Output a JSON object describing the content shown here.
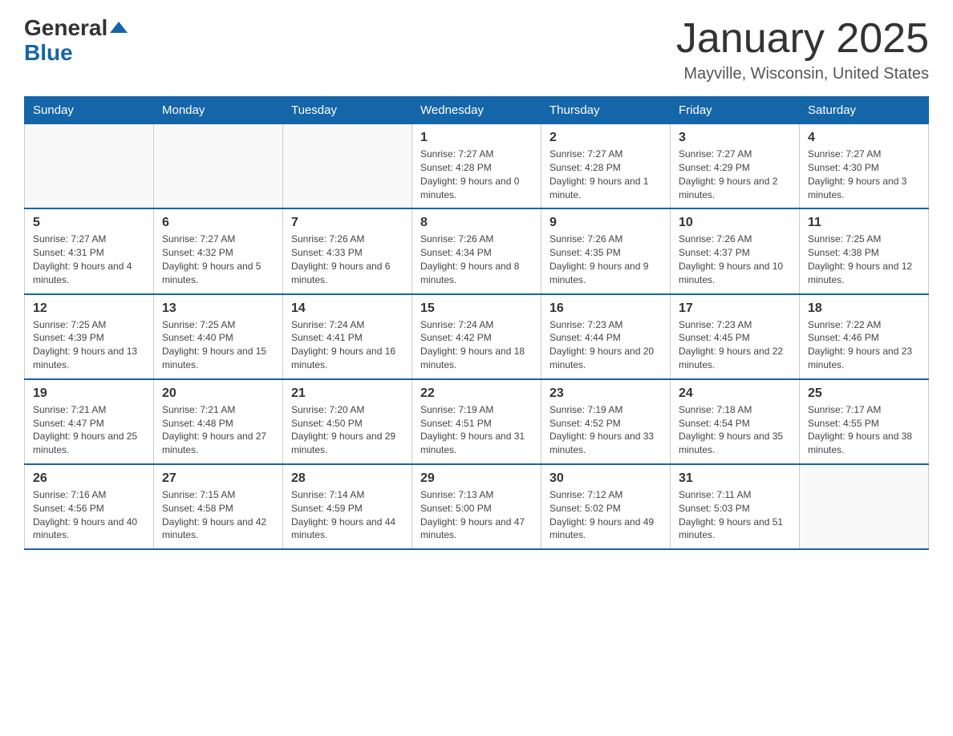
{
  "logo": {
    "general": "General",
    "blue": "Blue"
  },
  "header": {
    "title": "January 2025",
    "subtitle": "Mayville, Wisconsin, United States"
  },
  "weekdays": [
    "Sunday",
    "Monday",
    "Tuesday",
    "Wednesday",
    "Thursday",
    "Friday",
    "Saturday"
  ],
  "weeks": [
    [
      {
        "day": "",
        "sunrise": "",
        "sunset": "",
        "daylight": ""
      },
      {
        "day": "",
        "sunrise": "",
        "sunset": "",
        "daylight": ""
      },
      {
        "day": "",
        "sunrise": "",
        "sunset": "",
        "daylight": ""
      },
      {
        "day": "1",
        "sunrise": "Sunrise: 7:27 AM",
        "sunset": "Sunset: 4:28 PM",
        "daylight": "Daylight: 9 hours and 0 minutes."
      },
      {
        "day": "2",
        "sunrise": "Sunrise: 7:27 AM",
        "sunset": "Sunset: 4:28 PM",
        "daylight": "Daylight: 9 hours and 1 minute."
      },
      {
        "day": "3",
        "sunrise": "Sunrise: 7:27 AM",
        "sunset": "Sunset: 4:29 PM",
        "daylight": "Daylight: 9 hours and 2 minutes."
      },
      {
        "day": "4",
        "sunrise": "Sunrise: 7:27 AM",
        "sunset": "Sunset: 4:30 PM",
        "daylight": "Daylight: 9 hours and 3 minutes."
      }
    ],
    [
      {
        "day": "5",
        "sunrise": "Sunrise: 7:27 AM",
        "sunset": "Sunset: 4:31 PM",
        "daylight": "Daylight: 9 hours and 4 minutes."
      },
      {
        "day": "6",
        "sunrise": "Sunrise: 7:27 AM",
        "sunset": "Sunset: 4:32 PM",
        "daylight": "Daylight: 9 hours and 5 minutes."
      },
      {
        "day": "7",
        "sunrise": "Sunrise: 7:26 AM",
        "sunset": "Sunset: 4:33 PM",
        "daylight": "Daylight: 9 hours and 6 minutes."
      },
      {
        "day": "8",
        "sunrise": "Sunrise: 7:26 AM",
        "sunset": "Sunset: 4:34 PM",
        "daylight": "Daylight: 9 hours and 8 minutes."
      },
      {
        "day": "9",
        "sunrise": "Sunrise: 7:26 AM",
        "sunset": "Sunset: 4:35 PM",
        "daylight": "Daylight: 9 hours and 9 minutes."
      },
      {
        "day": "10",
        "sunrise": "Sunrise: 7:26 AM",
        "sunset": "Sunset: 4:37 PM",
        "daylight": "Daylight: 9 hours and 10 minutes."
      },
      {
        "day": "11",
        "sunrise": "Sunrise: 7:25 AM",
        "sunset": "Sunset: 4:38 PM",
        "daylight": "Daylight: 9 hours and 12 minutes."
      }
    ],
    [
      {
        "day": "12",
        "sunrise": "Sunrise: 7:25 AM",
        "sunset": "Sunset: 4:39 PM",
        "daylight": "Daylight: 9 hours and 13 minutes."
      },
      {
        "day": "13",
        "sunrise": "Sunrise: 7:25 AM",
        "sunset": "Sunset: 4:40 PM",
        "daylight": "Daylight: 9 hours and 15 minutes."
      },
      {
        "day": "14",
        "sunrise": "Sunrise: 7:24 AM",
        "sunset": "Sunset: 4:41 PM",
        "daylight": "Daylight: 9 hours and 16 minutes."
      },
      {
        "day": "15",
        "sunrise": "Sunrise: 7:24 AM",
        "sunset": "Sunset: 4:42 PM",
        "daylight": "Daylight: 9 hours and 18 minutes."
      },
      {
        "day": "16",
        "sunrise": "Sunrise: 7:23 AM",
        "sunset": "Sunset: 4:44 PM",
        "daylight": "Daylight: 9 hours and 20 minutes."
      },
      {
        "day": "17",
        "sunrise": "Sunrise: 7:23 AM",
        "sunset": "Sunset: 4:45 PM",
        "daylight": "Daylight: 9 hours and 22 minutes."
      },
      {
        "day": "18",
        "sunrise": "Sunrise: 7:22 AM",
        "sunset": "Sunset: 4:46 PM",
        "daylight": "Daylight: 9 hours and 23 minutes."
      }
    ],
    [
      {
        "day": "19",
        "sunrise": "Sunrise: 7:21 AM",
        "sunset": "Sunset: 4:47 PM",
        "daylight": "Daylight: 9 hours and 25 minutes."
      },
      {
        "day": "20",
        "sunrise": "Sunrise: 7:21 AM",
        "sunset": "Sunset: 4:48 PM",
        "daylight": "Daylight: 9 hours and 27 minutes."
      },
      {
        "day": "21",
        "sunrise": "Sunrise: 7:20 AM",
        "sunset": "Sunset: 4:50 PM",
        "daylight": "Daylight: 9 hours and 29 minutes."
      },
      {
        "day": "22",
        "sunrise": "Sunrise: 7:19 AM",
        "sunset": "Sunset: 4:51 PM",
        "daylight": "Daylight: 9 hours and 31 minutes."
      },
      {
        "day": "23",
        "sunrise": "Sunrise: 7:19 AM",
        "sunset": "Sunset: 4:52 PM",
        "daylight": "Daylight: 9 hours and 33 minutes."
      },
      {
        "day": "24",
        "sunrise": "Sunrise: 7:18 AM",
        "sunset": "Sunset: 4:54 PM",
        "daylight": "Daylight: 9 hours and 35 minutes."
      },
      {
        "day": "25",
        "sunrise": "Sunrise: 7:17 AM",
        "sunset": "Sunset: 4:55 PM",
        "daylight": "Daylight: 9 hours and 38 minutes."
      }
    ],
    [
      {
        "day": "26",
        "sunrise": "Sunrise: 7:16 AM",
        "sunset": "Sunset: 4:56 PM",
        "daylight": "Daylight: 9 hours and 40 minutes."
      },
      {
        "day": "27",
        "sunrise": "Sunrise: 7:15 AM",
        "sunset": "Sunset: 4:58 PM",
        "daylight": "Daylight: 9 hours and 42 minutes."
      },
      {
        "day": "28",
        "sunrise": "Sunrise: 7:14 AM",
        "sunset": "Sunset: 4:59 PM",
        "daylight": "Daylight: 9 hours and 44 minutes."
      },
      {
        "day": "29",
        "sunrise": "Sunrise: 7:13 AM",
        "sunset": "Sunset: 5:00 PM",
        "daylight": "Daylight: 9 hours and 47 minutes."
      },
      {
        "day": "30",
        "sunrise": "Sunrise: 7:12 AM",
        "sunset": "Sunset: 5:02 PM",
        "daylight": "Daylight: 9 hours and 49 minutes."
      },
      {
        "day": "31",
        "sunrise": "Sunrise: 7:11 AM",
        "sunset": "Sunset: 5:03 PM",
        "daylight": "Daylight: 9 hours and 51 minutes."
      },
      {
        "day": "",
        "sunrise": "",
        "sunset": "",
        "daylight": ""
      }
    ]
  ]
}
